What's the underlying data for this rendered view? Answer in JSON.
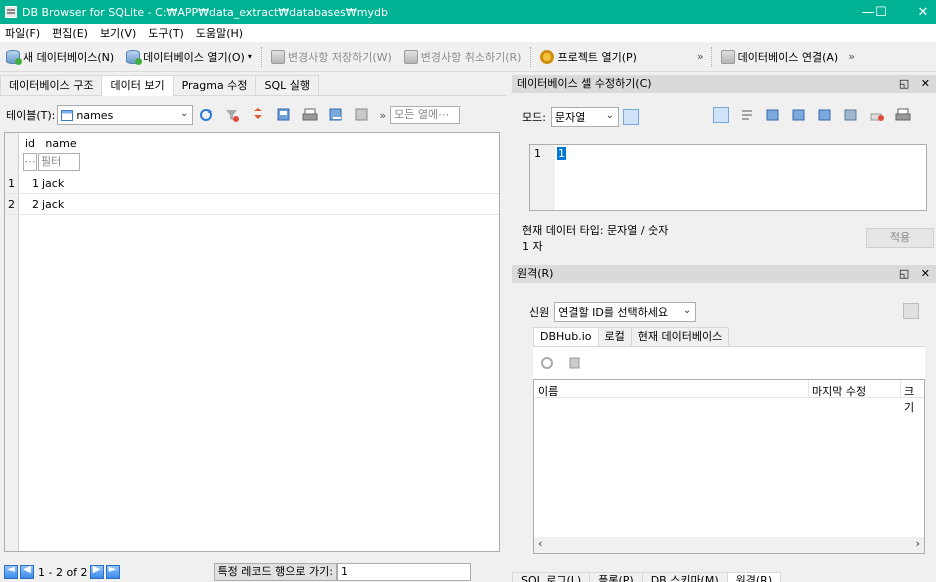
{
  "window": {
    "title": "DB Browser for SQLite - C:₩APP₩data_extract₩databases₩mydb",
    "minimize": "—",
    "maximize": "☐",
    "close": "✕"
  },
  "menu": [
    "파일(F)",
    "편집(E)",
    "보기(V)",
    "도구(T)",
    "도움말(H)"
  ],
  "toolbar": {
    "new_db": "새 데이터베이스(N)",
    "open_db": "데이터베이스 열기(O)",
    "write_changes": "변경사항 저장하기(W)",
    "revert_changes": "변경사항 취소하기(R)",
    "open_project": "프로젝트 열기(P)",
    "attach_db": "데이터베이스 연결(A)",
    "more": "»"
  },
  "left_tabs": [
    "데이터베이스 구조",
    "데이터 보기",
    "Pragma 수정",
    "SQL 실행"
  ],
  "browse": {
    "table_label": "테이블(T):",
    "table_value": "names",
    "filter_all_placeholder": "모든 열에⋯",
    "more": "»",
    "columns": [
      "id",
      "name"
    ],
    "filter_placeholder": "필터",
    "filter_id": "⋯",
    "rows": [
      {
        "num": "1",
        "id": "1",
        "name": "jack"
      },
      {
        "num": "2",
        "id": "2",
        "name": "jack"
      }
    ],
    "record_range": "1 - 2 of 2",
    "goto_label": "특정 레코드 행으로 가기:",
    "goto_value": "1"
  },
  "edit_cell": {
    "title": "데이터베이스 셀 수정하기(C)",
    "mode_label": "모드:",
    "mode_value": "문자열",
    "line_number": "1",
    "cell_value": "1",
    "type_info": "현재 데이터 타입: 문자열 / 숫자",
    "size_info": "1 자",
    "apply": "적용"
  },
  "remote": {
    "title": "원격(R)",
    "identity_label": "신원",
    "identity_value": "연결할 ID를 선택하세요",
    "tabs": [
      "DBHub.io",
      "로컬",
      "현재 데이터베이스"
    ],
    "columns": [
      "이름",
      "마지막 수정",
      "크기"
    ]
  },
  "bottom_tabs": [
    "SQL 로그(L)",
    "플롯(P)",
    "DB 스키마(M)",
    "원격(R)"
  ],
  "dock_buttons": "◱ ✕"
}
